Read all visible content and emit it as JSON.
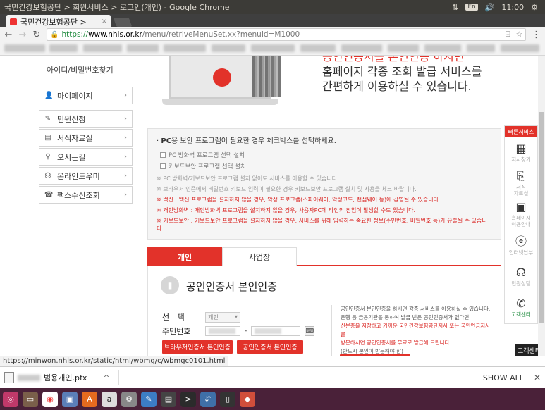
{
  "window": {
    "title": "국민건강보험공단 > 회원서비스 > 로그인(개인) - Google Chrome",
    "tray": {
      "keyboard": "En",
      "time": "11:00"
    }
  },
  "browser": {
    "tab_title": "국민건강보험공단 > ",
    "tab_close": "×",
    "url_scheme": "https://",
    "url_host": "www.nhis.or.kr",
    "url_rest": "/menu/retriveMenuSet.xx?menuId=M1000",
    "status_url": "https://minwon.nhis.or.kr/static/html/wbmg/c/wbmgc0101.html"
  },
  "page": {
    "find_id": "아이디/비밀번호찾기",
    "side_menu": [
      {
        "label": "마이페이지",
        "icon": "person-icon",
        "glyph": "👤"
      },
      {
        "label": "민원신청",
        "icon": "form-icon",
        "glyph": "✎"
      },
      {
        "label": "서식자료실",
        "icon": "folder-icon",
        "glyph": "▤"
      },
      {
        "label": "오시는길",
        "icon": "location-pin-icon",
        "glyph": "⚲"
      },
      {
        "label": "온라인도우미",
        "icon": "headset-icon",
        "glyph": "☊"
      },
      {
        "label": "팩스수신조회",
        "icon": "fax-icon",
        "glyph": "☎"
      }
    ],
    "hero": {
      "line1": "공인인증서를 본인인증 하시면",
      "line1_red": "공인인증서를 본인인증",
      "line2": "홈페이지 각종 조회 발급 서비스를",
      "line3": "간편하게 이용하실 수 있습니다."
    },
    "security": {
      "title_bold": "PC",
      "title": "용 보안 프로그램이 필요한 경우 체크박스를 선택하세요.",
      "options": [
        "PC 방화벽 프로그램 선택 설치",
        "키보드보안 프로그램 선택 설치"
      ],
      "notes": [
        {
          "text": "※ PC 방화벽/키보드보안 프로그램 설치 없이도 서비스를 이용할 수 있습니다.",
          "red": false
        },
        {
          "text": "※ 브라우저 인증에서 비밀번호 키보드 입력이 필요한 경우 키보드보안 프로그램 설치 및 사용을 체크 바랍니다.",
          "red": false
        },
        {
          "text": "※ 백신 : 백신 프로그램을 설치하지 않을 경우, 악성 프로그램(스파이웨어, 악성코드, 랜섬웨어 등)에 감염될 수 있습니다.",
          "red": true
        },
        {
          "text": "※ 개인방화벽 : 개인방화벽 프로그램을 설치하지 않을 경우, 사용자PC에 타인의 침입이 발생할 수도 있습니다.",
          "red": true
        },
        {
          "text": "※ 키보드보안 : 키보드보안 프로그램을 설치하지 않을 경우, 서비스를 위해 입력하는 중요한 정보(주민번호, 비밀번호 등)가 유출될 수 있습니다.",
          "red": true
        }
      ]
    },
    "tabs": [
      "개인",
      "사업장"
    ],
    "cert": {
      "title": "공인인증서 본인인증",
      "select_label": "선 택",
      "select_value": "개인",
      "id_label": "주민번호",
      "id_dash": "-",
      "btn_browser": "브라우저인증서 본인인증",
      "btn_cert": "공인인증서 본인인증",
      "info1": "공인인증서 본인인증을 하시면 각종 서비스를 이용하실 수 있습니다.",
      "info2": "은행 등 금융기관을 통하여 발급 받은 공인인증서가 없다면",
      "info3": "신분증을 지참하고 가까운 국민건강보험공단지사 또는 국민연금지사를",
      "info4": "방문하시면 공인인증서를 무료로 발급해 드립니다.",
      "info5": "(반드시 본인이 방문해야 함)"
    },
    "quick_menu": {
      "title": "빠른서비스",
      "items": [
        {
          "label": "지사찾기",
          "icon": "building-icon",
          "glyph": "▦"
        },
        {
          "label": "서식\n자료실",
          "icon": "document-search-icon",
          "glyph": "⎘"
        },
        {
          "label": "홈페이지\n이용안내",
          "icon": "guide-icon",
          "glyph": "▣"
        },
        {
          "label": "인터넷납부",
          "icon": "internet-payment-icon",
          "glyph": "ⓔ"
        },
        {
          "label": "민원상담",
          "icon": "headset-icon",
          "glyph": "☊"
        },
        {
          "label": "고객센터",
          "icon": "phone-icon",
          "glyph": "✆"
        }
      ],
      "tooltip": "고객센터"
    }
  },
  "downloads": {
    "file_name": "범용개인.pfx",
    "show_all": "SHOW ALL"
  },
  "colors": {
    "brand_red": "#e2322a",
    "launcher": "#4a2139"
  }
}
